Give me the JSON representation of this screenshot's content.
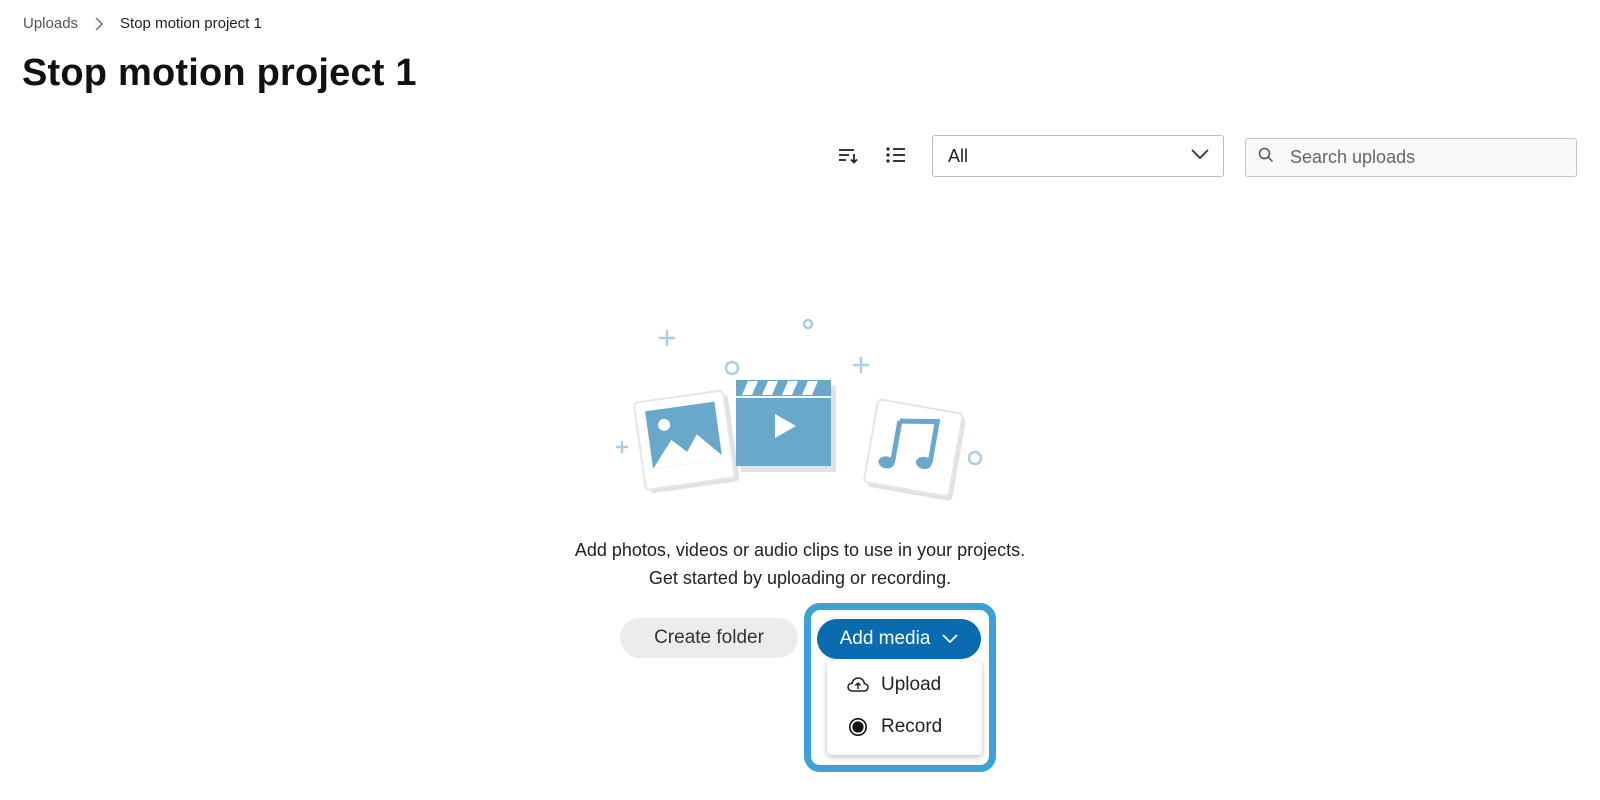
{
  "breadcrumb": {
    "parent": "Uploads",
    "current": "Stop motion project 1"
  },
  "page_title": "Stop motion project 1",
  "toolbar": {
    "sort_icon": "sort-icon",
    "view_icon": "list-view-icon",
    "filter": {
      "selected": "All"
    },
    "search": {
      "placeholder": "Search uploads",
      "value": ""
    }
  },
  "empty_state": {
    "illustration": [
      "image-icon",
      "video-clapper-icon",
      "music-note-icon"
    ],
    "message": "Add photos, videos or audio clips to use in your projects. Get started by uploading or recording.",
    "create_folder_label": "Create folder",
    "add_media_label": "Add media"
  },
  "add_media_menu": {
    "items": [
      {
        "label": "Upload",
        "icon": "cloud-upload-icon"
      },
      {
        "label": "Record",
        "icon": "record-icon"
      }
    ]
  },
  "colors": {
    "primary": "#0a6bb0",
    "focus_ring": "#3ba1d6",
    "illustration": "#6aa8cb"
  }
}
